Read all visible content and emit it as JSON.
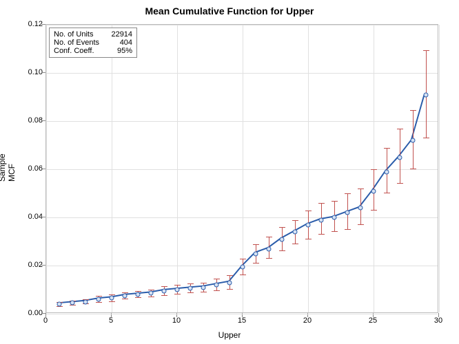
{
  "chart_data": {
    "type": "line",
    "title": "Mean Cumulative Function for Upper",
    "xlabel": "Upper",
    "ylabel": "Sample MCF",
    "xlim": [
      0,
      30
    ],
    "ylim": [
      0,
      0.12
    ],
    "x_ticks": [
      0,
      5,
      10,
      15,
      20,
      25,
      30
    ],
    "y_ticks": [
      0.0,
      0.02,
      0.04,
      0.06,
      0.08,
      0.1,
      0.12
    ],
    "info_box": {
      "units_label": "No. of Units",
      "units_value": "22914",
      "events_label": "No. of Events",
      "events_value": "404",
      "conf_label": "Conf. Coeff.",
      "conf_value": "95%"
    },
    "series": [
      {
        "name": "Sample MCF",
        "color_line": "#2a5caa",
        "color_error": "#c0504d",
        "x": [
          1,
          2,
          3,
          4,
          5,
          6,
          7,
          8,
          9,
          10,
          11,
          12,
          13,
          14,
          15,
          16,
          17,
          18,
          19,
          20,
          21,
          22,
          23,
          24,
          25,
          26,
          27,
          28,
          29
        ],
        "y": [
          0.004,
          0.0045,
          0.005,
          0.006,
          0.0065,
          0.0075,
          0.008,
          0.0085,
          0.0095,
          0.01,
          0.0105,
          0.011,
          0.012,
          0.013,
          0.0195,
          0.025,
          0.027,
          0.031,
          0.034,
          0.037,
          0.039,
          0.04,
          0.042,
          0.044,
          0.051,
          0.059,
          0.065,
          0.072,
          0.091
        ],
        "lo": [
          0.003,
          0.0035,
          0.004,
          0.0045,
          0.005,
          0.006,
          0.0065,
          0.007,
          0.0075,
          0.008,
          0.0085,
          0.009,
          0.0095,
          0.01,
          0.016,
          0.021,
          0.023,
          0.026,
          0.029,
          0.031,
          0.033,
          0.034,
          0.035,
          0.037,
          0.043,
          0.05,
          0.054,
          0.06,
          0.073
        ],
        "hi": [
          0.005,
          0.0055,
          0.006,
          0.0075,
          0.008,
          0.009,
          0.0095,
          0.01,
          0.0115,
          0.012,
          0.0125,
          0.013,
          0.0145,
          0.016,
          0.023,
          0.029,
          0.032,
          0.036,
          0.039,
          0.043,
          0.046,
          0.047,
          0.05,
          0.052,
          0.06,
          0.069,
          0.077,
          0.0845,
          0.1095
        ]
      }
    ]
  }
}
